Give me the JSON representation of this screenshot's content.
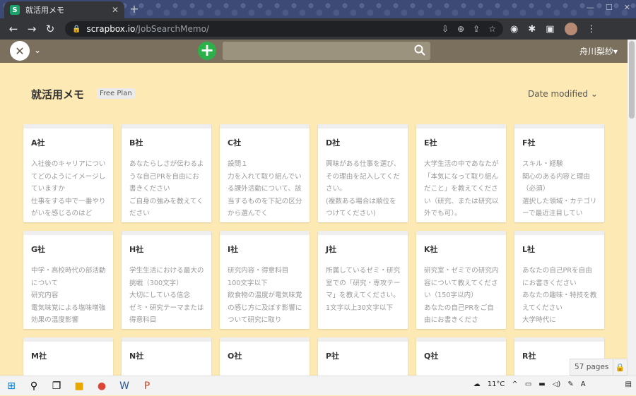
{
  "browser": {
    "tab_title": "就活用メモ",
    "tab_close": "✕",
    "new_tab": "+",
    "window_controls": [
      "—",
      "☐",
      "✕"
    ],
    "url_host": "scrapbox.io",
    "url_path": "/JobSearchMemo/"
  },
  "app": {
    "search_placeholder": "",
    "user_name": "舟川梨紗▾"
  },
  "page": {
    "title": "就活用メモ",
    "plan_badge": "Free Plan",
    "sort_label": "Date modified ⌄",
    "page_count": "57 pages"
  },
  "cards": [
    {
      "title": "A社",
      "body": "入社後のキャリアについてどのようにイメージしていますか\n仕事をする中で一番やりがいを感じるのはど"
    },
    {
      "title": "B社",
      "body": "あなたらしさが伝わるような自己PRを自由にお書きください\nご自身の強みを教えてください"
    },
    {
      "title": "C社",
      "body": "設問１\n力を入れて取り組んでいる課外活動について、該当するものを下記の区分から選んでく"
    },
    {
      "title": "D社",
      "body": "興味がある仕事を選び、その理由を記入してください。\n(複数ある場合は順位をつけてください)"
    },
    {
      "title": "E社",
      "body": "大学生活の中であなたが「本気になって取り組んだこと」を教えてください（研究、または研究以外でも可）。"
    },
    {
      "title": "F社",
      "body": "スキル・経験\n関心のある内容と理由（必須）\n選択した領域・カテゴリーで最近注目してい"
    },
    {
      "title": "G社",
      "body": "中学・高校時代の部活動について\n研究内容\n電気味覚による塩味増強効果の温度影響"
    },
    {
      "title": "H社",
      "body": "学生生活における最大の挑戦（300文字）\n大切にしている信念\nゼミ・研究テーマまたは得意科目"
    },
    {
      "title": "I社",
      "body": "研究内容・得意科目\n100文字以下\n飲食物の温度が電気味覚の感じ方に及ぼす影響について研究に取り"
    },
    {
      "title": "J社",
      "body": "所属しているゼミ・研究室での「研究・専攻テーマ」を教えてください。1文字以上30文字以下"
    },
    {
      "title": "K社",
      "body": "研究室・ゼミでの研究内容について教えてください（150字以内）\nあなたの自己PRをご自由にお書きくださ"
    },
    {
      "title": "L社",
      "body": "あなたの自己PRを自由にお書きください\nあなたの趣味・特技を教えてください\n大学時代に"
    },
    {
      "title": "M社",
      "body": ""
    },
    {
      "title": "N社",
      "body": ""
    },
    {
      "title": "O社",
      "body": ""
    },
    {
      "title": "P社",
      "body": ""
    },
    {
      "title": "Q社",
      "body": ""
    },
    {
      "title": "R社",
      "body": ""
    }
  ],
  "taskbar": {
    "weather": "11°C",
    "ime": "A"
  }
}
